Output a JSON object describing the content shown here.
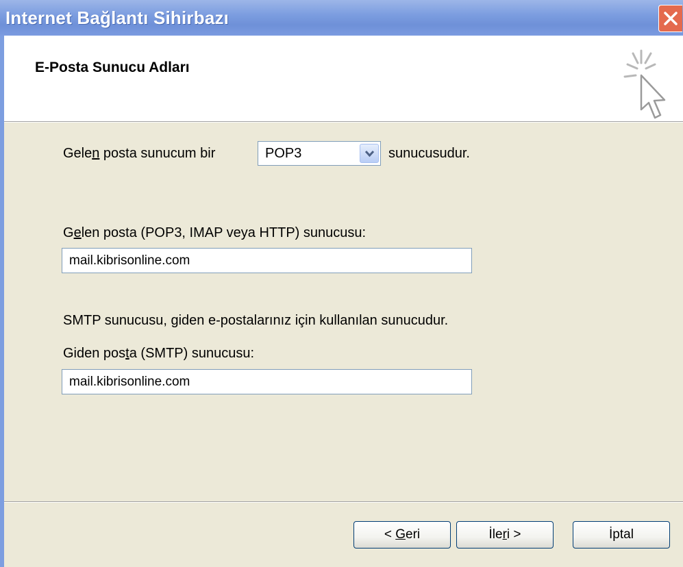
{
  "window": {
    "title": "Internet Bağlantı Sihirbazı",
    "accent_color": "#7d9ee0",
    "close_icon": "close-icon"
  },
  "header": {
    "title": "E-Posta Sunucu Adları",
    "icon": "wizard-cursor-icon"
  },
  "incoming_type": {
    "label_pre": "Gele",
    "label_accel": "n",
    "label_post": " posta sunucum bir",
    "selected": "POP3",
    "suffix": "sunucusudur."
  },
  "incoming_server": {
    "label_pre": "G",
    "label_accel": "e",
    "label_post": "len posta (POP3, IMAP veya HTTP) sunucusu:",
    "value": "mail.kibrisonline.com"
  },
  "smtp": {
    "description": "SMTP sunucusu, giden e-postalarınız için kullanılan sunucudur.",
    "label_pre": "Giden pos",
    "label_accel": "t",
    "label_post": "a (SMTP) sunucusu:",
    "value": "mail.kibrisonline.com"
  },
  "buttons": {
    "back_pre": "< ",
    "back_accel": "G",
    "back_post": "eri",
    "next_pre": "İle",
    "next_accel": "r",
    "next_post": "i >",
    "cancel": "İptal"
  }
}
